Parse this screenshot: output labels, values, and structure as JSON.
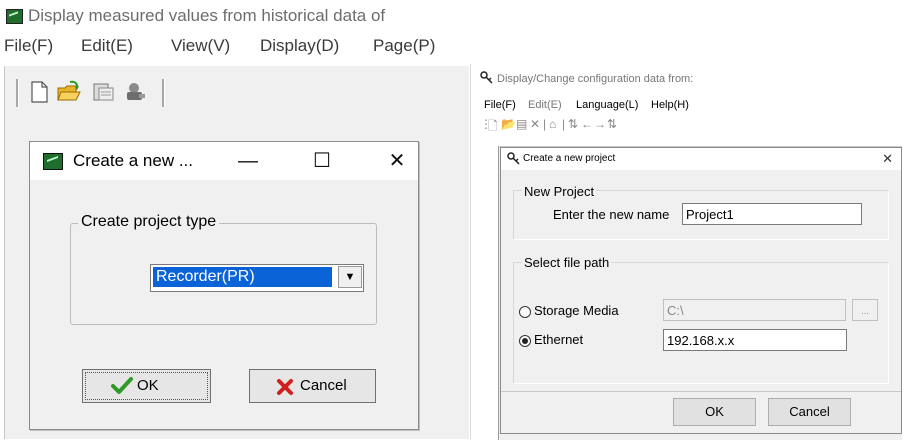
{
  "left_window": {
    "title": "Display measured values from historical data of",
    "menu": [
      "File(F)",
      "Edit(E)",
      "View(V)",
      "Display(D)",
      "Page(P)"
    ],
    "toolbar_icons": [
      "new-file-icon",
      "open-folder-icon",
      "save-print-icon",
      "tools-icon"
    ],
    "dialog": {
      "title": "Create a new ...",
      "minimize": "—",
      "maximize": "☐",
      "close": "✕",
      "group_label": "Create project type",
      "project_type_value": "Recorder(PR)",
      "dropdown_arrow": "▼",
      "ok_label": "OK",
      "cancel_label": "Cancel"
    }
  },
  "right_window": {
    "title": "Display/Change configuration data from:",
    "menu": [
      "File(F)",
      "Edit(E)",
      "Language(L)",
      "Help(H)"
    ],
    "toolbar_icons": [
      "new-icon",
      "open-icon",
      "save-icon",
      "delete-icon",
      "network-icon",
      "transfer-icon",
      "left-arrow-icon",
      "right-arrow-icon",
      "sync-icon",
      "copy-icon",
      "export-icon"
    ],
    "dialog": {
      "title": "Create a new project",
      "close": "✕",
      "new_project_group": "New Project",
      "name_label": "Enter the new name",
      "name_value": "Project1",
      "file_path_group": "Select file path",
      "storage_label": "Storage Media",
      "storage_value": "C:\\",
      "browse_label": "...",
      "ethernet_label": "Ethernet",
      "ethernet_value": "192.168.x.x",
      "selected_option": "Ethernet",
      "ok_label": "OK",
      "cancel_label": "Cancel"
    }
  },
  "colors": {
    "selection_blue": "#0a64d8",
    "ok_check_green": "#2f9a27",
    "cancel_x_red": "#d0201f",
    "window_bg": "#f0f0f0"
  }
}
